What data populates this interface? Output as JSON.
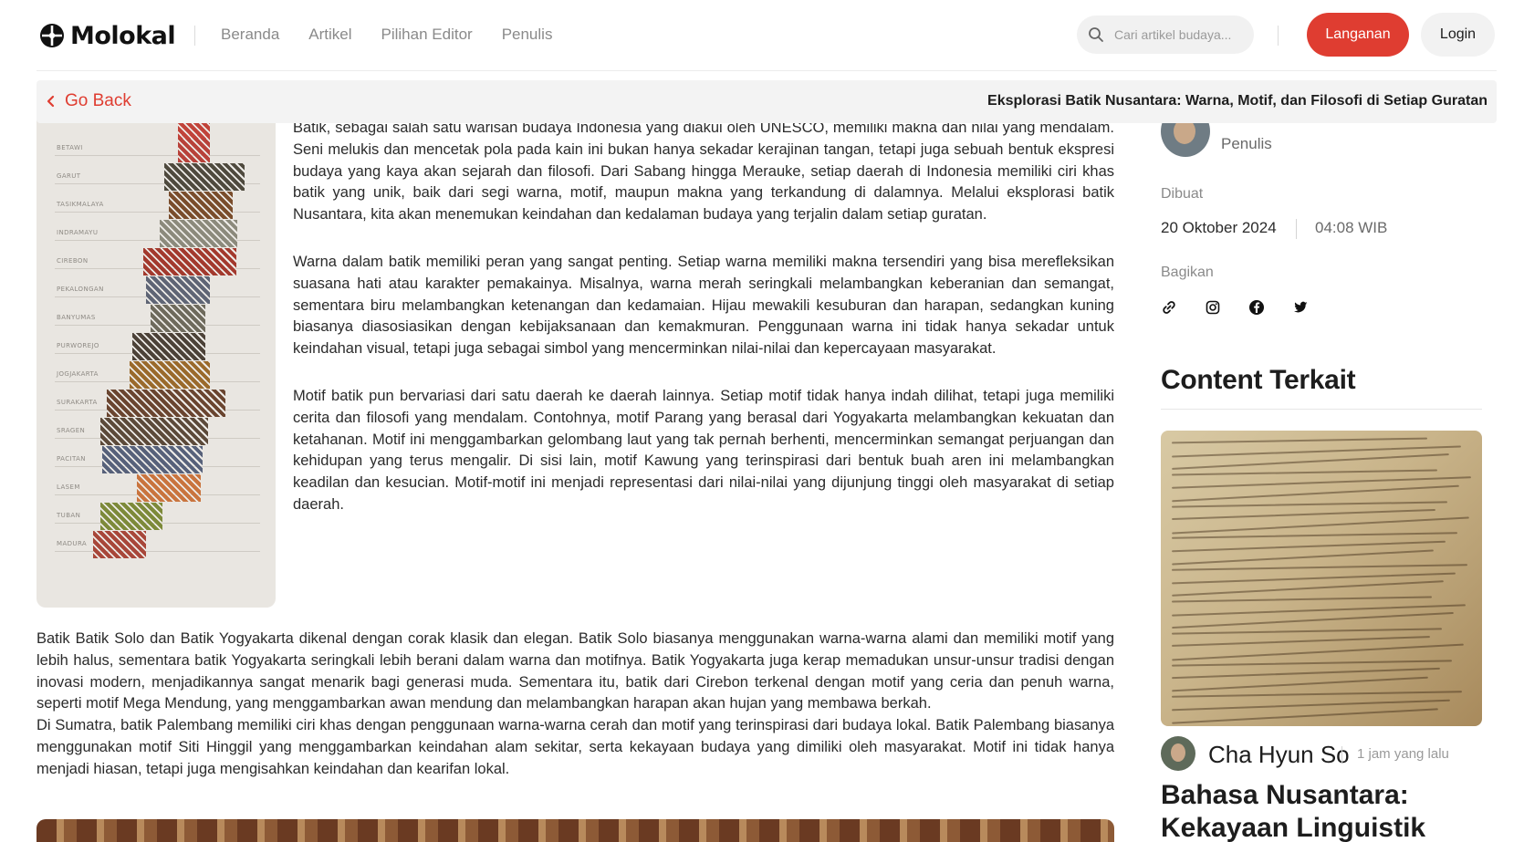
{
  "header": {
    "logo_text": "Molokal",
    "nav": [
      "Beranda",
      "Artikel",
      "Pilihan Editor",
      "Penulis"
    ],
    "search_placeholder": "Cari artikel budaya...",
    "subscribe_label": "Langanan",
    "login_label": "Login",
    "accent_color": "#df3d31"
  },
  "backbar": {
    "back_label": "Go Back",
    "title": "Eksplorasi Batik Nusantara: Warna, Motif, dan Filosofi di Setiap Guratan"
  },
  "article": {
    "image_regions": [
      "BETAWI",
      "GARUT",
      "TASIKMALAYA",
      "INDRAMAYU",
      "CIREBON",
      "PEKALONGAN",
      "BANYUMAS",
      "PURWOREJO",
      "JOGJAKARTA",
      "SURAKARTA",
      "SRAGEN",
      "PACITAN",
      "LASEM",
      "TUBAN",
      "MADURA"
    ],
    "p1": "Batik, sebagai salah satu warisan budaya Indonesia yang diakui oleh UNESCO, memiliki makna dan nilai yang mendalam. Seni melukis dan mencetak pola pada kain ini bukan hanya sekadar kerajinan tangan, tetapi juga sebuah bentuk ekspresi budaya yang kaya akan sejarah dan filosofi. Dari Sabang hingga Merauke, setiap daerah di Indonesia memiliki ciri khas batik yang unik, baik dari segi warna, motif, maupun makna yang terkandung di dalamnya. Melalui eksplorasi batik Nusantara, kita akan menemukan keindahan dan kedalaman budaya yang terjalin dalam setiap guratan.",
    "p2": "Warna dalam batik memiliki peran yang sangat penting. Setiap warna memiliki makna tersendiri yang bisa merefleksikan suasana hati atau karakter pemakainya. Misalnya, warna merah seringkali melambangkan keberanian dan semangat, sementara biru melambangkan ketenangan dan kedamaian. Hijau mewakili kesuburan dan harapan, sedangkan kuning biasanya diasosiasikan dengan kebijaksanaan dan kemakmuran. Penggunaan warna ini tidak hanya sekadar untuk keindahan visual, tetapi juga sebagai simbol yang mencerminkan nilai-nilai dan kepercayaan masyarakat.",
    "p3": "Motif batik pun bervariasi dari satu daerah ke daerah lainnya. Setiap motif tidak hanya indah dilihat, tetapi juga memiliki cerita dan filosofi yang mendalam. Contohnya, motif Parang yang berasal dari Yogyakarta melambangkan kekuatan dan ketahanan. Motif ini menggambarkan gelombang laut yang tak pernah berhenti, mencerminkan semangat perjuangan dan kehidupan yang terus mengalir. Di sisi lain, motif Kawung yang terinspirasi dari bentuk buah aren ini melambangkan keadilan dan kesucian. Motif-motif ini menjadi representasi dari nilai-nilai yang dijunjung tinggi oleh masyarakat di setiap daerah.",
    "p4": "Batik Batik Solo dan Batik Yogyakarta dikenal dengan corak klasik dan elegan. Batik Solo biasanya menggunakan warna-warna alami dan memiliki motif yang lebih halus, sementara batik Yogyakarta seringkali lebih berani dalam warna dan motifnya. Batik Yogyakarta juga kerap memadukan unsur-unsur tradisi dengan inovasi modern, menjadikannya sangat menarik bagi generasi muda. Sementara itu, batik dari Cirebon terkenal dengan motif yang ceria dan penuh warna, seperti motif Mega Mendung, yang menggambarkan awan mendung dan melambangkan harapan akan hujan yang membawa berkah.",
    "p5": "Di Sumatra, batik Palembang memiliki ciri khas dengan penggunaan warna-warna cerah dan motif yang terinspirasi dari budaya lokal. Batik Palembang biasanya menggunakan motif Siti Hinggil yang menggambarkan keindahan alam sekitar, serta kekayaan budaya yang dimiliki oleh masyarakat. Motif ini tidak hanya menjadi hiasan, tetapi juga mengisahkan keindahan dan kearifan lokal."
  },
  "sidebar": {
    "author_role": "Penulis",
    "created_label": "Dibuat",
    "date": "20 Oktober 2024",
    "time": "04:08 WIB",
    "share_label": "Bagikan",
    "share_icons": [
      "link-icon",
      "instagram-icon",
      "facebook-icon",
      "twitter-icon"
    ],
    "related_title": "Content Terkait",
    "related": {
      "author": "Cha Hyun So",
      "time": "1 jam yang lalu",
      "headline": "Bahasa Nusantara: Kekayaan Linguistik"
    }
  }
}
